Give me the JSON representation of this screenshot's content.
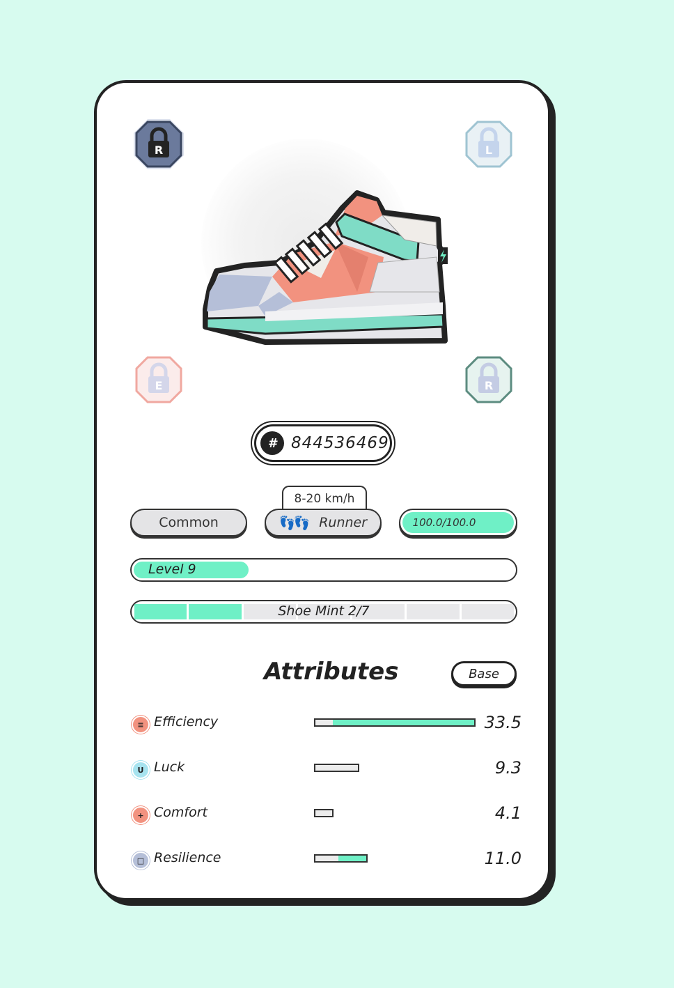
{
  "locks": [
    {
      "letter": "R",
      "state": "unlocked",
      "color": "#6b7a9c"
    },
    {
      "letter": "L",
      "state": "locked",
      "color": "#c9dde6"
    },
    {
      "letter": "E",
      "state": "locked",
      "color": "#f0c4c0"
    },
    {
      "letter": "R",
      "state": "locked",
      "color": "#b9dad2"
    }
  ],
  "sneaker": {
    "id": "844536469",
    "hash_symbol": "#"
  },
  "rarity": "Common",
  "type": {
    "label": "Runner",
    "speed": "8-20 km/h"
  },
  "durability": "100.0/100.0",
  "level": {
    "label": "Level 9",
    "progress": 0.3
  },
  "mint": {
    "label": "Shoe Mint 2/7",
    "used": 2,
    "total": 7
  },
  "attributes": {
    "title": "Attributes",
    "toggle": "Base",
    "items": [
      {
        "name": "Efficiency",
        "value": "33.5",
        "icon": "efficiency-icon",
        "color": "#f2927f",
        "base_fraction": 0.11,
        "total": 1.0
      },
      {
        "name": "Luck",
        "value": "9.3",
        "icon": "luck-icon",
        "color": "#a6e3ef",
        "base_fraction": 1.0,
        "total": 0.28
      },
      {
        "name": "Comfort",
        "value": "4.1",
        "icon": "comfort-icon",
        "color": "#f2927f",
        "base_fraction": 1.0,
        "total": 0.12
      },
      {
        "name": "Resilience",
        "value": "11.0",
        "icon": "resilience-icon",
        "color": "#b5bfd8",
        "base_fraction": 0.45,
        "total": 0.33
      }
    ]
  },
  "colors": {
    "accent": "#6ff0c6",
    "background": "#d7fbef",
    "ink": "#232323",
    "shoe_primary": "#f2927f",
    "shoe_secondary": "#7fdcc6"
  }
}
